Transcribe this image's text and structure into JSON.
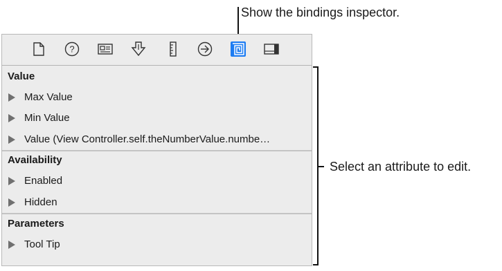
{
  "callouts": {
    "top": "Show the bindings inspector.",
    "right": "Select an attribute to edit."
  },
  "toolbar": {
    "icons": [
      {
        "name": "file-inspector-icon"
      },
      {
        "name": "quick-help-icon"
      },
      {
        "name": "identity-inspector-icon"
      },
      {
        "name": "attributes-inspector-icon"
      },
      {
        "name": "size-inspector-icon"
      },
      {
        "name": "connections-inspector-icon"
      },
      {
        "name": "bindings-inspector-icon",
        "active": true
      },
      {
        "name": "view-effects-inspector-icon"
      }
    ],
    "active_color": "#1d7cf2"
  },
  "sections": [
    {
      "title": "Value",
      "items": [
        "Max Value",
        "Min Value",
        "Value (View Controller.self.theNumberValue.numbe…"
      ]
    },
    {
      "title": "Availability",
      "items": [
        "Enabled",
        "Hidden"
      ]
    },
    {
      "title": "Parameters",
      "items": [
        "Tool Tip"
      ]
    }
  ]
}
